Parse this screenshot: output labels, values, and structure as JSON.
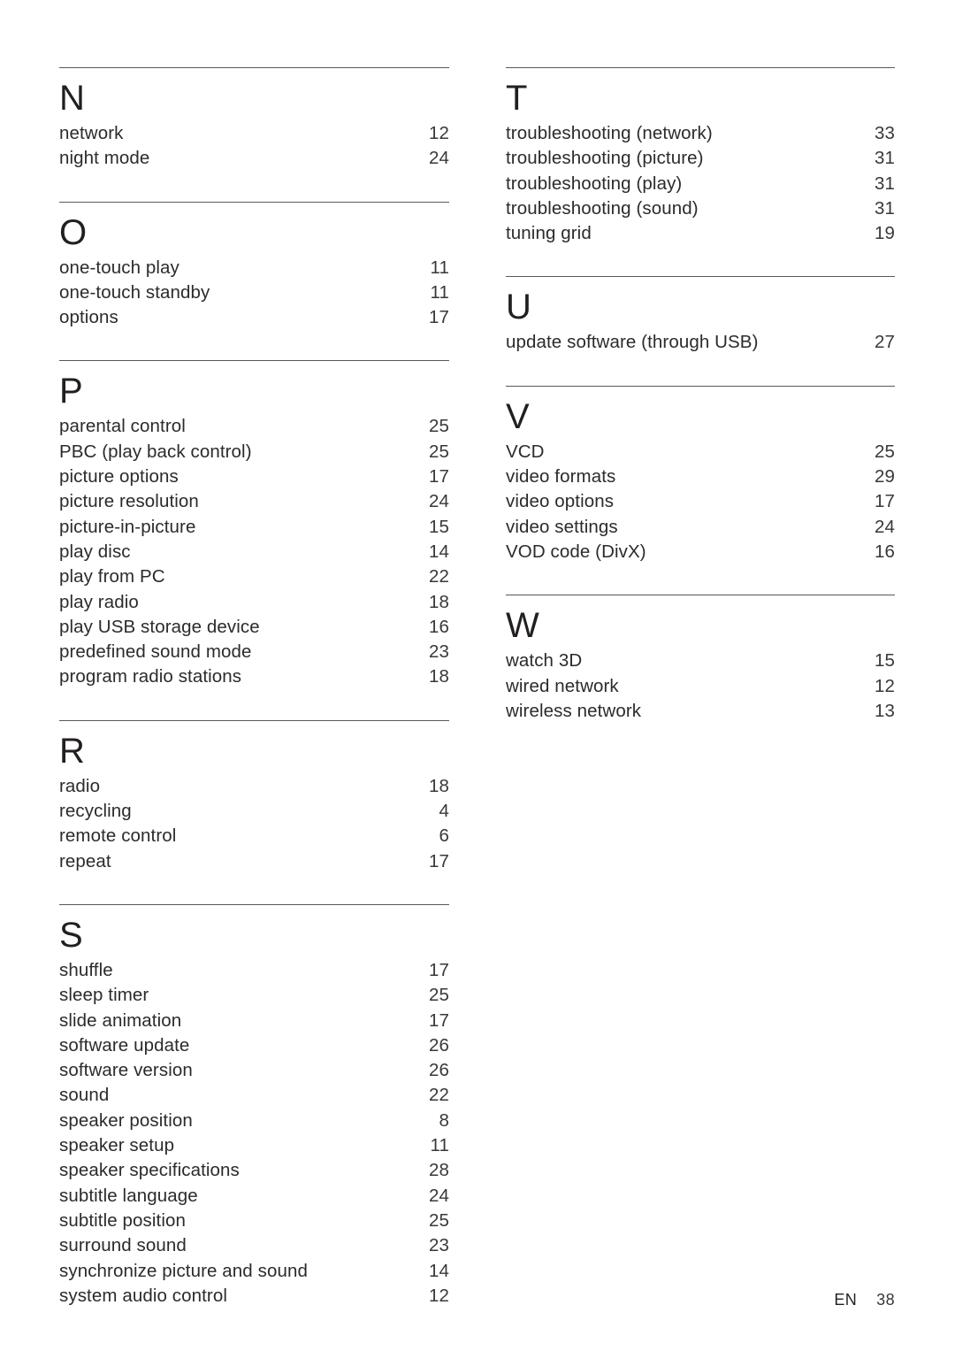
{
  "document": {
    "type": "index",
    "footer": {
      "language": "EN",
      "page_number": "38"
    }
  },
  "columns": [
    {
      "name": "left-column",
      "sections": [
        {
          "letter": "N",
          "entries": [
            {
              "label": "network",
              "page": "12"
            },
            {
              "label": "night mode",
              "page": "24"
            }
          ]
        },
        {
          "letter": "O",
          "entries": [
            {
              "label": "one-touch play",
              "page": "11"
            },
            {
              "label": "one-touch standby",
              "page": "11"
            },
            {
              "label": "options",
              "page": "17"
            }
          ]
        },
        {
          "letter": "P",
          "entries": [
            {
              "label": "parental control",
              "page": "25"
            },
            {
              "label": "PBC (play back control)",
              "page": "25"
            },
            {
              "label": "picture options",
              "page": "17"
            },
            {
              "label": "picture resolution",
              "page": "24"
            },
            {
              "label": "picture-in-picture",
              "page": "15"
            },
            {
              "label": "play disc",
              "page": "14"
            },
            {
              "label": "play from PC",
              "page": "22"
            },
            {
              "label": "play radio",
              "page": "18"
            },
            {
              "label": "play USB storage device",
              "page": "16"
            },
            {
              "label": "predefined sound mode",
              "page": "23"
            },
            {
              "label": "program radio stations",
              "page": "18"
            }
          ]
        },
        {
          "letter": "R",
          "entries": [
            {
              "label": "radio",
              "page": "18"
            },
            {
              "label": "recycling",
              "page": "4"
            },
            {
              "label": "remote control",
              "page": "6"
            },
            {
              "label": "repeat",
              "page": "17"
            }
          ]
        },
        {
          "letter": "S",
          "entries": [
            {
              "label": "shuffle",
              "page": "17"
            },
            {
              "label": "sleep timer",
              "page": "25"
            },
            {
              "label": "slide animation",
              "page": "17"
            },
            {
              "label": "software update",
              "page": "26"
            },
            {
              "label": "software version",
              "page": "26"
            },
            {
              "label": "sound",
              "page": "22"
            },
            {
              "label": "speaker position",
              "page": "8"
            },
            {
              "label": "speaker setup",
              "page": "11"
            },
            {
              "label": "speaker specifications",
              "page": "28"
            },
            {
              "label": "subtitle language",
              "page": "24"
            },
            {
              "label": "subtitle position",
              "page": "25"
            },
            {
              "label": "surround sound",
              "page": "23"
            },
            {
              "label": "synchronize picture and sound",
              "page": "14"
            },
            {
              "label": "system audio control",
              "page": "12"
            }
          ]
        }
      ]
    },
    {
      "name": "right-column",
      "sections": [
        {
          "letter": "T",
          "entries": [
            {
              "label": "troubleshooting (network)",
              "page": "33"
            },
            {
              "label": "troubleshooting (picture)",
              "page": "31"
            },
            {
              "label": "troubleshooting (play)",
              "page": "31"
            },
            {
              "label": "troubleshooting (sound)",
              "page": "31"
            },
            {
              "label": "tuning grid",
              "page": "19"
            }
          ]
        },
        {
          "letter": "U",
          "entries": [
            {
              "label": "update software (through USB)",
              "page": "27"
            }
          ]
        },
        {
          "letter": "V",
          "entries": [
            {
              "label": "VCD",
              "page": "25"
            },
            {
              "label": "video formats",
              "page": "29"
            },
            {
              "label": "video options",
              "page": "17"
            },
            {
              "label": "video settings",
              "page": "24"
            },
            {
              "label": "VOD code (DivX)",
              "page": "16"
            }
          ]
        },
        {
          "letter": "W",
          "entries": [
            {
              "label": "watch 3D",
              "page": "15"
            },
            {
              "label": "wired network",
              "page": "12"
            },
            {
              "label": "wireless network",
              "page": "13"
            }
          ]
        }
      ]
    }
  ]
}
